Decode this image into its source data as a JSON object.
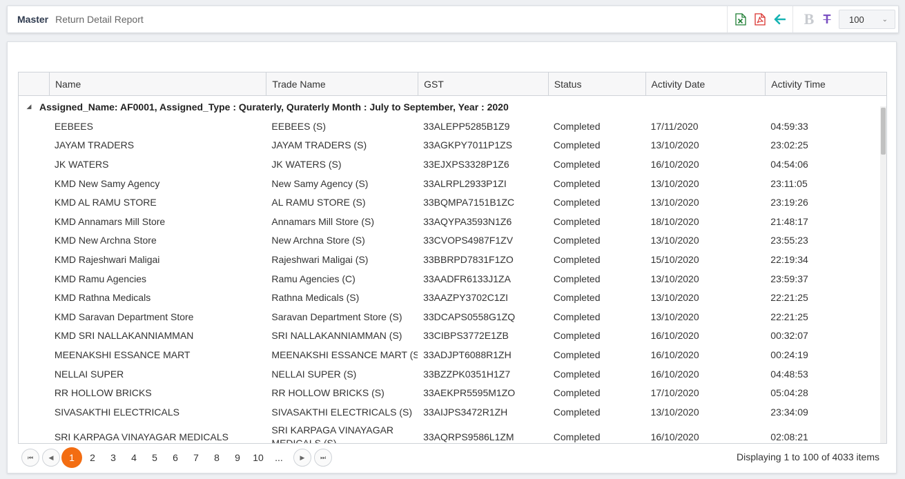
{
  "breadcrumb": {
    "master": "Master",
    "report": "Return Detail Report"
  },
  "toolbar": {
    "excel_icon": "excel-export-icon",
    "pdf_icon": "pdf-export-icon",
    "back_icon": "back-arrow-icon",
    "bold_label": "B",
    "strike_label": "T",
    "page_size": "100",
    "colors": {
      "excel": "#1e7e34",
      "pdf": "#d9302c",
      "back": "#16b3b3",
      "strike": "#7a4fc1",
      "active_page": "#f36d12"
    }
  },
  "grid": {
    "columns": [
      "Name",
      "Trade Name",
      "GST",
      "Status",
      "Activity Date",
      "Activity Time"
    ],
    "group_label": "Assigned_Name: AF0001, Assigned_Type : Quraterly, Quraterly Month : July to September, Year : 2020",
    "rows": [
      [
        "EEBEES",
        "EEBEES (S)",
        "33ALEPP5285B1Z9",
        "Completed",
        "17/11/2020",
        "04:59:33"
      ],
      [
        "JAYAM TRADERS",
        "JAYAM TRADERS (S)",
        "33AGKPY7011P1ZS",
        "Completed",
        "13/10/2020",
        "23:02:25"
      ],
      [
        "JK WATERS",
        "JK WATERS (S)",
        "33EJXPS3328P1Z6",
        "Completed",
        "16/10/2020",
        "04:54:06"
      ],
      [
        "KMD New Samy Agency",
        "New Samy Agency (S)",
        "33ALRPL2933P1ZI",
        "Completed",
        "13/10/2020",
        "23:11:05"
      ],
      [
        "KMD AL RAMU STORE",
        "AL RAMU STORE (S)",
        "33BQMPA7151B1ZC",
        "Completed",
        "13/10/2020",
        "23:19:26"
      ],
      [
        "KMD Annamars Mill Store",
        "Annamars Mill Store (S)",
        "33AQYPA3593N1Z6",
        "Completed",
        "18/10/2020",
        "21:48:17"
      ],
      [
        "KMD New Archna Store",
        "New Archna Store (S)",
        "33CVOPS4987F1ZV",
        "Completed",
        "13/10/2020",
        "23:55:23"
      ],
      [
        "KMD Rajeshwari Maligai",
        "Rajeshwari Maligai (S)",
        "33BBRPD7831F1ZO",
        "Completed",
        "15/10/2020",
        "22:19:34"
      ],
      [
        "KMD Ramu Agencies",
        "Ramu Agencies (C)",
        "33AADFR6133J1ZA",
        "Completed",
        "13/10/2020",
        "23:59:37"
      ],
      [
        "KMD Rathna Medicals",
        "Rathna Medicals (S)",
        "33AAZPY3702C1ZI",
        "Completed",
        "13/10/2020",
        "22:21:25"
      ],
      [
        "KMD Saravan Department Store",
        "Saravan Department Store (S)",
        "33DCAPS0558G1ZQ",
        "Completed",
        "13/10/2020",
        "22:21:25"
      ],
      [
        "KMD SRI NALLAKANNIAMMAN",
        "SRI NALLAKANNIAMMAN (S)",
        "33CIBPS3772E1ZB",
        "Completed",
        "16/10/2020",
        "00:32:07"
      ],
      [
        "MEENAKSHI ESSANCE MART",
        "MEENAKSHI ESSANCE MART (S)",
        "33ADJPT6088R1ZH",
        "Completed",
        "16/10/2020",
        "00:24:19"
      ],
      [
        "NELLAI SUPER",
        "NELLAI SUPER (S)",
        "33BZZPK0351H1Z7",
        "Completed",
        "16/10/2020",
        "04:48:53"
      ],
      [
        "RR HOLLOW BRICKS",
        "RR HOLLOW BRICKS (S)",
        "33AEKPR5595M1ZO",
        "Completed",
        "17/10/2020",
        "05:04:28"
      ],
      [
        "SIVASAKTHI ELECTRICALS",
        "SIVASAKTHI ELECTRICALS (S)",
        "33AIJPS3472R1ZH",
        "Completed",
        "13/10/2020",
        "23:34:09"
      ],
      [
        "SRI KARPAGA VINAYAGAR MEDICALS",
        "SRI KARPAGA VINAYAGAR MEDICALS (S)",
        "33AQRPS9586L1ZM",
        "Completed",
        "16/10/2020",
        "02:08:21"
      ]
    ]
  },
  "pager": {
    "pages": [
      "1",
      "2",
      "3",
      "4",
      "5",
      "6",
      "7",
      "8",
      "9",
      "10",
      "..."
    ],
    "active_page": "1",
    "info": "Displaying 1 to 100 of 4033 items"
  }
}
